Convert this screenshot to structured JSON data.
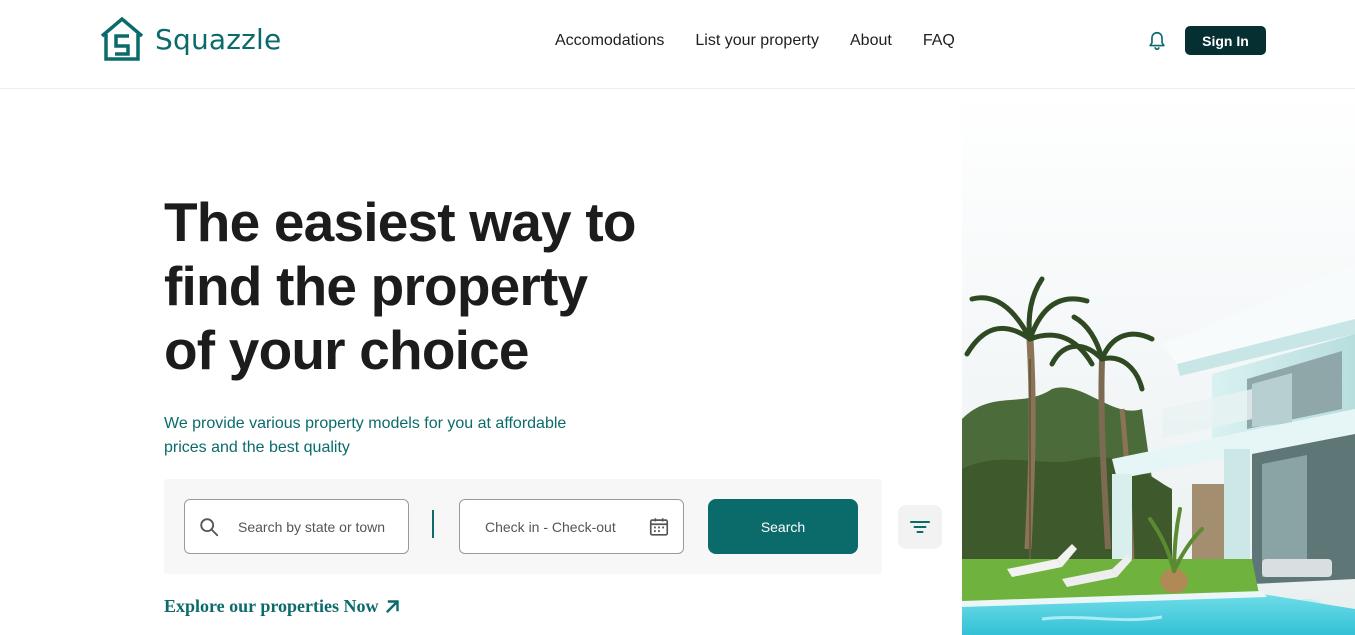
{
  "brand": {
    "name": "Squazzle",
    "color": "#0b6b6a"
  },
  "nav": {
    "items": [
      {
        "label": "Accomodations"
      },
      {
        "label": "List your property"
      },
      {
        "label": "About"
      },
      {
        "label": "FAQ"
      }
    ]
  },
  "header": {
    "notification_icon": "bell-icon",
    "signin_label": "Sign In",
    "signin_color": "#062f31"
  },
  "hero": {
    "title_lines": [
      "The easiest way to",
      "find the property",
      "of your choice"
    ],
    "subtitle": "We provide various property models for you at affordable prices and the best quality"
  },
  "search": {
    "location_placeholder": "Search by state or town",
    "location_icon": "search-icon",
    "dates_placeholder": "Check in - Check-out",
    "dates_icon": "calendar-icon",
    "button_label": "Search",
    "filter_icon": "filter-icon"
  },
  "explore": {
    "label": "Explore our properties Now",
    "icon": "arrow-up-right-icon"
  }
}
